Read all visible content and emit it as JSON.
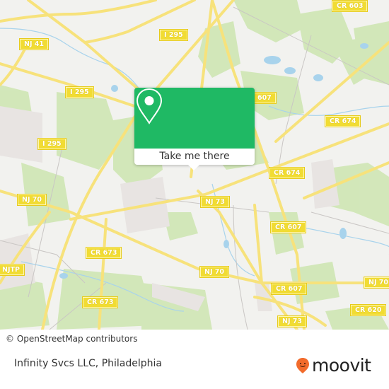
{
  "map": {
    "road_labels": [
      {
        "id": "cr603",
        "text": "CR 603"
      },
      {
        "id": "i295-top",
        "text": "I 295"
      },
      {
        "id": "nj41",
        "text": "NJ 41"
      },
      {
        "id": "i295-mid",
        "text": "I 295"
      },
      {
        "id": "i295-left",
        "text": "I 295"
      },
      {
        "id": "cr607-top",
        "text": "607"
      },
      {
        "id": "cr674-right",
        "text": "CR 674"
      },
      {
        "id": "cr674-mid",
        "text": "CR 674"
      },
      {
        "id": "nj70-left",
        "text": "NJ 70"
      },
      {
        "id": "nj73-top",
        "text": "NJ 73"
      },
      {
        "id": "cr607-mid",
        "text": "CR 607"
      },
      {
        "id": "cr673-top",
        "text": "CR 673"
      },
      {
        "id": "njtp",
        "text": "NJTP"
      },
      {
        "id": "nj70-mid",
        "text": "NJ 70"
      },
      {
        "id": "nj70-right",
        "text": "NJ 70"
      },
      {
        "id": "cr607-bottom",
        "text": "CR 607"
      },
      {
        "id": "cr673-bottom",
        "text": "CR 673"
      },
      {
        "id": "cr620",
        "text": "CR 620"
      },
      {
        "id": "nj73-bottom",
        "text": "NJ 73"
      }
    ],
    "attribution": "© OpenStreetMap contributors"
  },
  "popup": {
    "icon": "map-pin-icon",
    "action_label": "Take me there",
    "accent_color": "#1fb964"
  },
  "footer": {
    "place_title": "Infinity Svcs LLC, Philadelphia",
    "brand_name": "moovit",
    "brand_color": "#f26b2b"
  }
}
